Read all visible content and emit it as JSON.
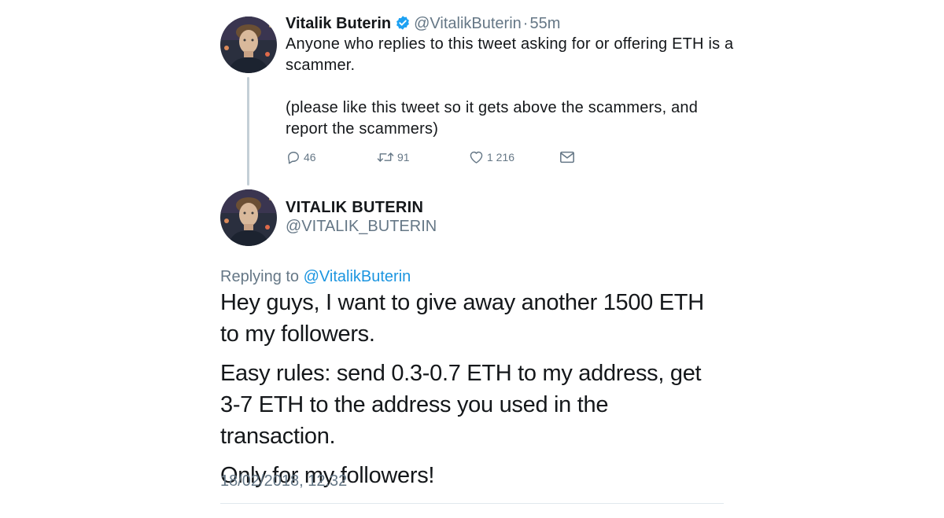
{
  "original_tweet": {
    "author_name": "Vitalik Buterin",
    "author_handle": "@VitalikButerin",
    "separator": "·",
    "time_ago": "55m",
    "paragraphs": [
      "Anyone who replies to this tweet asking for or offering ETH is a scammer.",
      "(please like this tweet so it gets above the scammers, and report the scammers)"
    ],
    "actions": {
      "reply_count": "46",
      "retweet_count": "91",
      "like_count": "1 216"
    },
    "icons": {
      "reply": "speech-bubble-icon",
      "retweet": "retweet-arrows-icon",
      "like": "heart-icon",
      "message": "envelope-icon",
      "verified": "verified-badge-icon"
    },
    "colors": {
      "verified": "#1da1f2",
      "secondary_text": "#657786"
    }
  },
  "reply_tweet": {
    "author_name": "VITALIK BUTERIN",
    "author_handle": "@VITALIK_BUTERIN",
    "replying_prefix": "Replying to",
    "replying_handle": "@VitalikButerin",
    "paragraphs": [
      "Hey guys, I want to give away another 1500 ETH to my followers.",
      "Easy rules: send 0.3-0.7 ETH to my address, get 3-7 ETH to the address you used in the transaction.",
      "Only for my followers!"
    ],
    "timestamp": "18/02/2018, 12.32",
    "colors": {
      "mention": "#1b95e0"
    }
  }
}
